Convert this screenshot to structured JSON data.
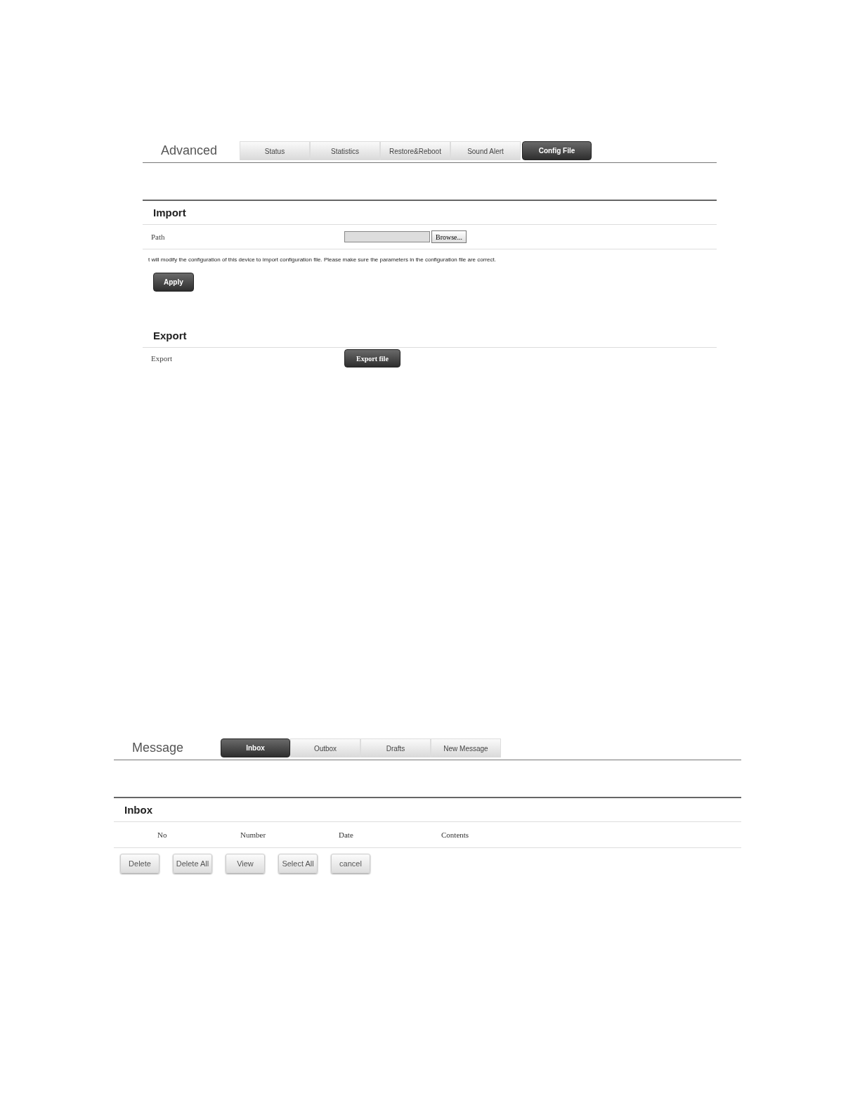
{
  "panels": [
    {
      "title": "Advanced",
      "tabs": [
        {
          "label": "Status",
          "selected": false
        },
        {
          "label": "Statistics",
          "selected": false
        },
        {
          "label": "Restore&Reboot",
          "selected": false
        },
        {
          "label": "Sound Alert",
          "selected": false
        },
        {
          "label": "Config File",
          "selected": true
        }
      ],
      "sections": [
        {
          "kind": "form",
          "heading": "Import",
          "rows": [
            {
              "kind": "file",
              "label": "Path",
              "button": "Browse..."
            }
          ],
          "note": "t will modify the configuration of this device to import configuration file. Please make sure the parameters in the configuration file are correct.",
          "action": "Apply"
        },
        {
          "kind": "form",
          "heading": "Export",
          "rows": [
            {
              "kind": "button",
              "label": "Export",
              "button": "Export file"
            }
          ]
        }
      ]
    },
    {
      "title": "Message",
      "tabs": [
        {
          "label": "Inbox",
          "selected": true
        },
        {
          "label": "Outbox",
          "selected": false
        },
        {
          "label": "Drafts",
          "selected": false
        },
        {
          "label": "New Message",
          "selected": false
        }
      ],
      "sections": [
        {
          "kind": "table",
          "heading": "Inbox",
          "columns": [
            "No",
            "Number",
            "Date",
            "Contents"
          ],
          "buttons": [
            "Delete",
            "Delete All",
            "View",
            "Select All",
            "cancel"
          ]
        }
      ]
    }
  ]
}
